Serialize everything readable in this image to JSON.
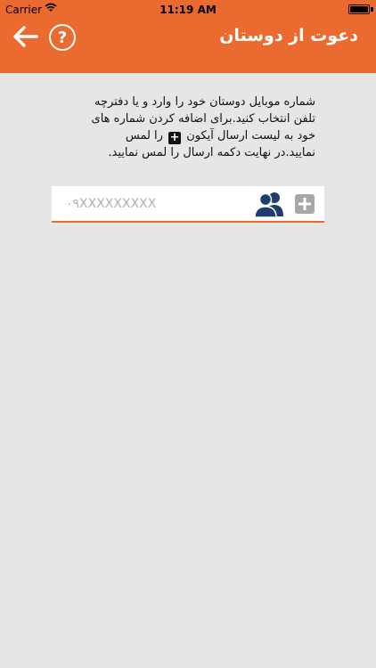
{
  "status_bar": {
    "carrier": "Carrier",
    "time": "11:19 AM",
    "battery_level": 1.0
  },
  "nav": {
    "title": "دعوت از دوستان",
    "back_icon": "arrow-left-icon",
    "help_icon": "question-circle-icon",
    "help_label": "?"
  },
  "instructions": {
    "part1": "شماره موبایل دوستان خود را وارد و یا دفترچه تلفن انتخاب کنید.برای اضافه کردن شماره های خود به لیست ارسال آیکون",
    "plus_glyph": "+",
    "part2": "را لمس نمایید.در نهایت دکمه ارسال را لمس نمایید."
  },
  "phone_input": {
    "value": "",
    "placeholder": "۰۹XXXXXXXXX"
  },
  "colors": {
    "accent": "#ea6a2f",
    "background": "#e6e6e6",
    "contacts_icon": "#1f3d6e",
    "add_button": "#a7a7a7"
  }
}
